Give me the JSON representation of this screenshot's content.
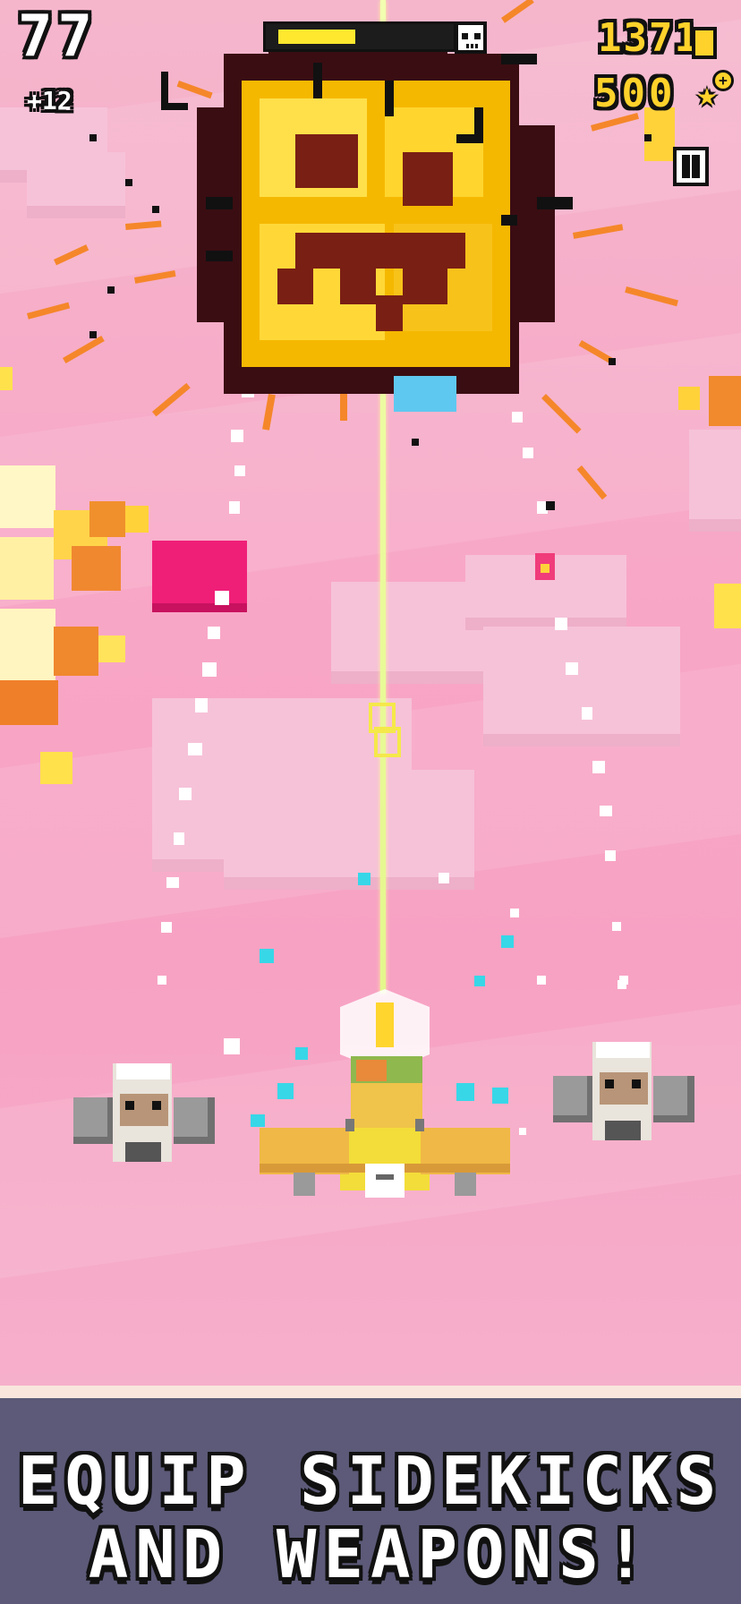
{
  "hud": {
    "score": "77",
    "score_bonus": "+12",
    "boss_health_fraction": 0.48,
    "coins": "1371",
    "gems": "500",
    "gem_add": "+"
  },
  "banner": {
    "line1": "EQUIP SIDEKICKS",
    "line2": "AND WEAPONS!"
  },
  "icons": {
    "coin": "coin-icon",
    "star": "star-icon",
    "skull": "skull-icon",
    "pause": "pause-icon"
  },
  "colors": {
    "sky": "#f7a9c6",
    "gold": "#ffd22b",
    "banner_bg": "#5c5a78",
    "health_fill": "#ffe82e"
  }
}
